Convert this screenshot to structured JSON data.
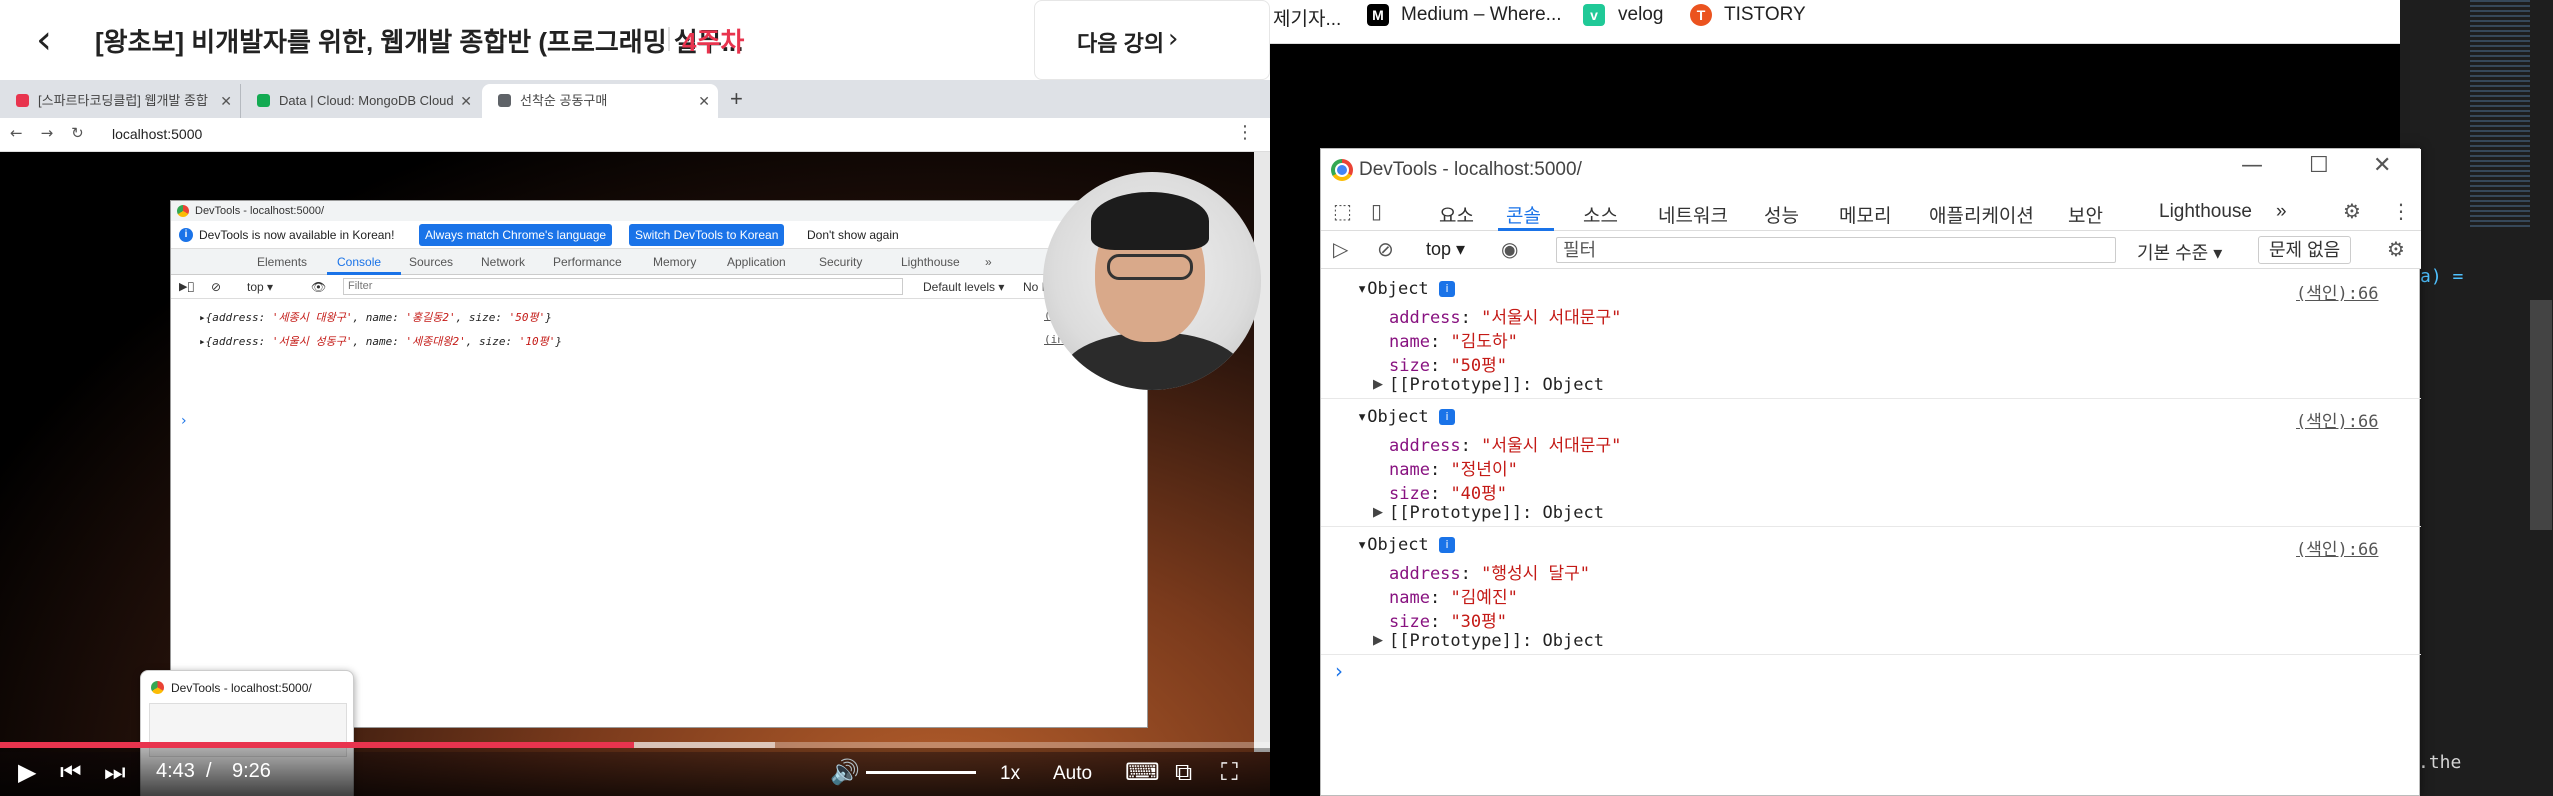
{
  "course": {
    "title": "[왕초보] 비개발자를 위한, 웹개발 종합반 (프로그래밍 실무...",
    "week": "4주차",
    "next_lesson": "다음 강의"
  },
  "video_browser": {
    "tabs": [
      {
        "label": "[스파르타코딩클럽] 웹개발 종합",
        "color": "#e8344e"
      },
      {
        "label": "Data | Cloud: MongoDB Cloud",
        "color": "#13aa52"
      },
      {
        "label": "선착순 공동구매",
        "color": "#5f6368"
      }
    ],
    "url": "localhost:5000",
    "devtools": {
      "title": "DevTools - localhost:5000/",
      "info_text": "DevTools is now available in Korean!",
      "btn_match": "Always match Chrome's language",
      "btn_switch": "Switch DevTools to Korean",
      "btn_dismiss": "Don't show again",
      "tabs": [
        "Elements",
        "Console",
        "Sources",
        "Network",
        "Performance",
        "Memory",
        "Application",
        "Security",
        "Lighthouse",
        "»"
      ],
      "context": "top ▾",
      "filter_placeholder": "Filter",
      "levels": "Default levels ▾",
      "issues": "No Issues",
      "logs": [
        {
          "text_prefix": "▸{address: ",
          "address": "'세종시 대왕구'",
          "mid1": ", name: ",
          "name": "'홍길동2'",
          "mid2": ", size: ",
          "size": "'50평'",
          "suffix": "}",
          "src": "(index):66"
        },
        {
          "text_prefix": "▸{address: ",
          "address": "'서울시 성동구'",
          "mid1": ", name: ",
          "name": "'세종대왕2'",
          "mid2": ", size: ",
          "size": "'10평'",
          "suffix": "}",
          "src": "(index):66"
        }
      ]
    },
    "hover_preview_title": "DevTools - localhost:5000/"
  },
  "player": {
    "current_time": "4:43",
    "separator": "/",
    "total_time": "9:26",
    "progress_fraction": 0.499,
    "buffer_fraction": 0.61,
    "speed": "1x",
    "quality": "Auto"
  },
  "bookmarks": [
    {
      "label": "제기자...",
      "icon": ""
    },
    {
      "label": "Medium – Where...",
      "icon": "M"
    },
    {
      "label": "velog",
      "icon": "v"
    },
    {
      "label": "TISTORY",
      "icon": "T"
    }
  ],
  "editor_fragments": [
    "a) =",
    ".the"
  ],
  "devtools": {
    "title": "DevTools - localhost:5000/",
    "panels": [
      "요소",
      "콘솔",
      "소스",
      "네트워크",
      "성능",
      "메모리",
      "애플리케이션",
      "보안",
      "Lighthouse",
      "»"
    ],
    "context": "top",
    "filter_placeholder": "필터",
    "level": "기본 수준 ▾",
    "issues": "문제 없음",
    "objects": [
      {
        "head": "Object",
        "address_key": "address",
        "address": "\"서울시 서대문구\"",
        "name_key": "name",
        "name": "\"김도하\"",
        "size_key": "size",
        "size": "\"50평\"",
        "proto": "[[Prototype]]: Object",
        "src": "(색인):66"
      },
      {
        "head": "Object",
        "address_key": "address",
        "address": "\"서울시 서대문구\"",
        "name_key": "name",
        "name": "\"정년이\"",
        "size_key": "size",
        "size": "\"40평\"",
        "proto": "[[Prototype]]: Object",
        "src": "(색인):66"
      },
      {
        "head": "Object",
        "address_key": "address",
        "address": "\"행성시 달구\"",
        "name_key": "name",
        "name": "\"김예진\"",
        "size_key": "size",
        "size": "\"30평\"",
        "proto": "[[Prototype]]: Object",
        "src": "(색인):66"
      }
    ]
  }
}
